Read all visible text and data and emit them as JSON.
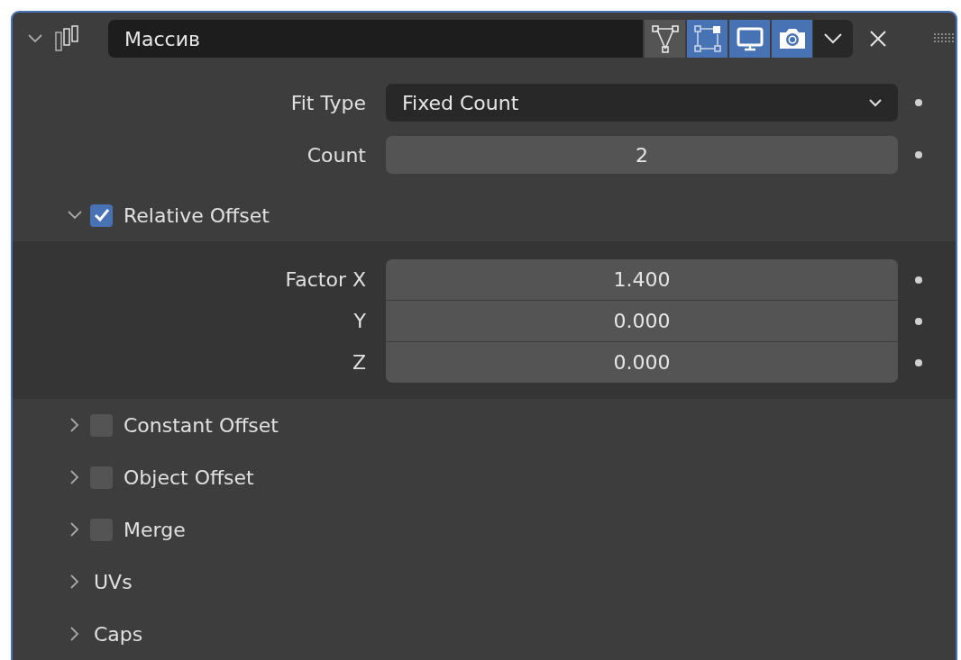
{
  "modifier": {
    "expanded": true,
    "name": "Массив",
    "toggles": [
      {
        "kind": "vertex",
        "selected": false
      },
      {
        "kind": "cage",
        "selected": true
      },
      {
        "kind": "monitor",
        "selected": true
      },
      {
        "kind": "camera",
        "selected": true
      }
    ]
  },
  "properties": [
    {
      "kind": "dropdown",
      "label": "Fit Type",
      "value": "Fixed Count"
    },
    {
      "kind": "number",
      "label": "Count",
      "value": "2"
    }
  ],
  "sections": [
    {
      "kind": "toggle",
      "label": "Relative Offset",
      "expanded": true,
      "checked": true,
      "fields": [
        {
          "label": "Factor X",
          "value": "1.400"
        },
        {
          "label": "Y",
          "value": "0.000"
        },
        {
          "label": "Z",
          "value": "0.000"
        }
      ]
    },
    {
      "kind": "toggle",
      "label": "Constant Offset",
      "expanded": false,
      "checked": false
    },
    {
      "kind": "toggle",
      "label": "Object Offset",
      "expanded": false,
      "checked": false
    },
    {
      "kind": "toggle",
      "label": "Merge",
      "expanded": false,
      "checked": false
    },
    {
      "kind": "plain",
      "label": "UVs",
      "expanded": false
    },
    {
      "kind": "plain",
      "label": "Caps",
      "expanded": false
    }
  ]
}
